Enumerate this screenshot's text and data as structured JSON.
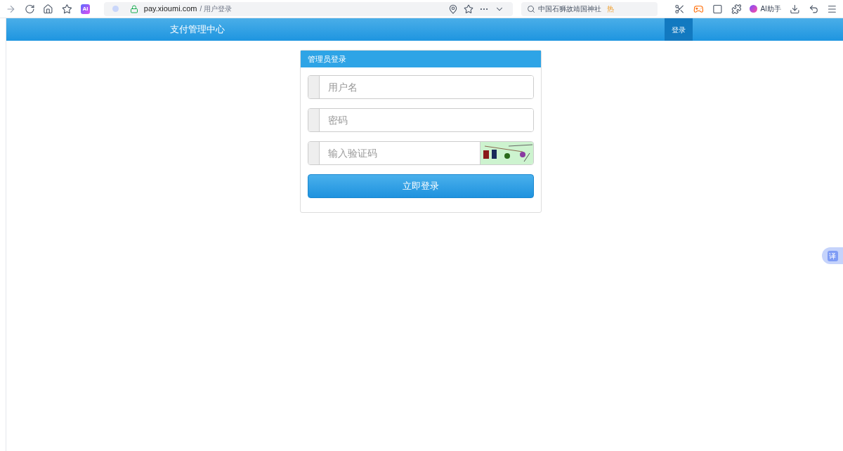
{
  "browser": {
    "url_host": "pay.xioumi.com",
    "url_path": "/ 用户登录",
    "ai_badge": "AI",
    "search": {
      "placeholder": "中国石狮故靖国神社"
    },
    "search_badge": "热",
    "assistant_label": "AI助手"
  },
  "header": {
    "title": "支付管理中心",
    "nav": [
      {
        "label": "登录",
        "selected": true
      }
    ]
  },
  "login_card": {
    "title": "管理员登录",
    "fields": [
      {
        "kind": "text",
        "placeholder": "用户名"
      },
      {
        "kind": "password",
        "placeholder": "密码"
      },
      {
        "kind": "captcha",
        "placeholder": "输入验证码"
      }
    ],
    "submit": "立即登录"
  },
  "translate_button": "译"
}
